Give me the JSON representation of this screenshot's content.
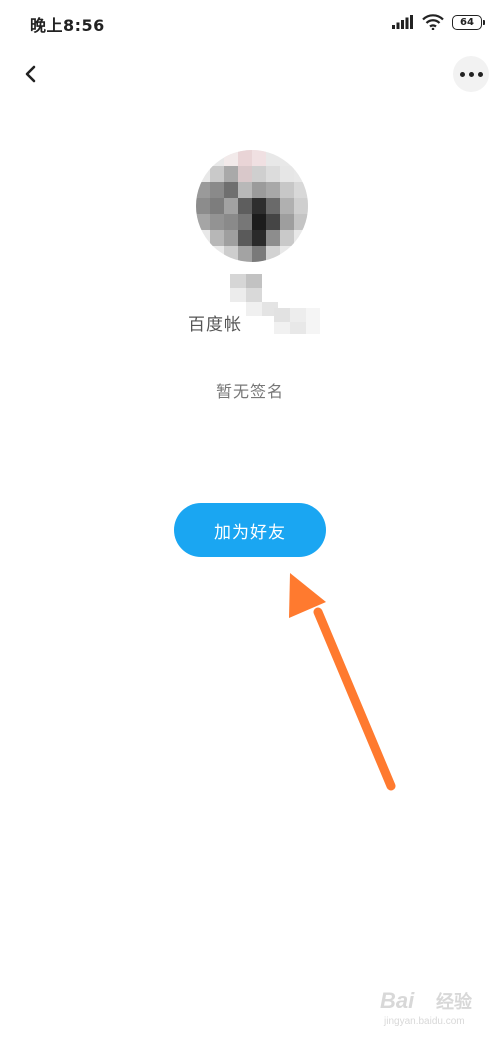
{
  "status_bar": {
    "time": "晚上8:56",
    "battery": "64",
    "icons": [
      "signal-icon",
      "wifi-icon",
      "battery-icon"
    ]
  },
  "nav": {
    "back_icon": "chevron-left-icon",
    "more_icon": "more-horizontal-icon"
  },
  "profile": {
    "name_visible": "百度帐",
    "signature": "暂无签名"
  },
  "actions": {
    "add_friend_label": "加为好友"
  },
  "colors": {
    "primary_button": "#1aa6f2",
    "annotation_arrow": "#ff7a2f"
  },
  "watermark": {
    "brand": "Bai",
    "brand_cn": "经验",
    "url": "jingyan.baidu.com"
  }
}
